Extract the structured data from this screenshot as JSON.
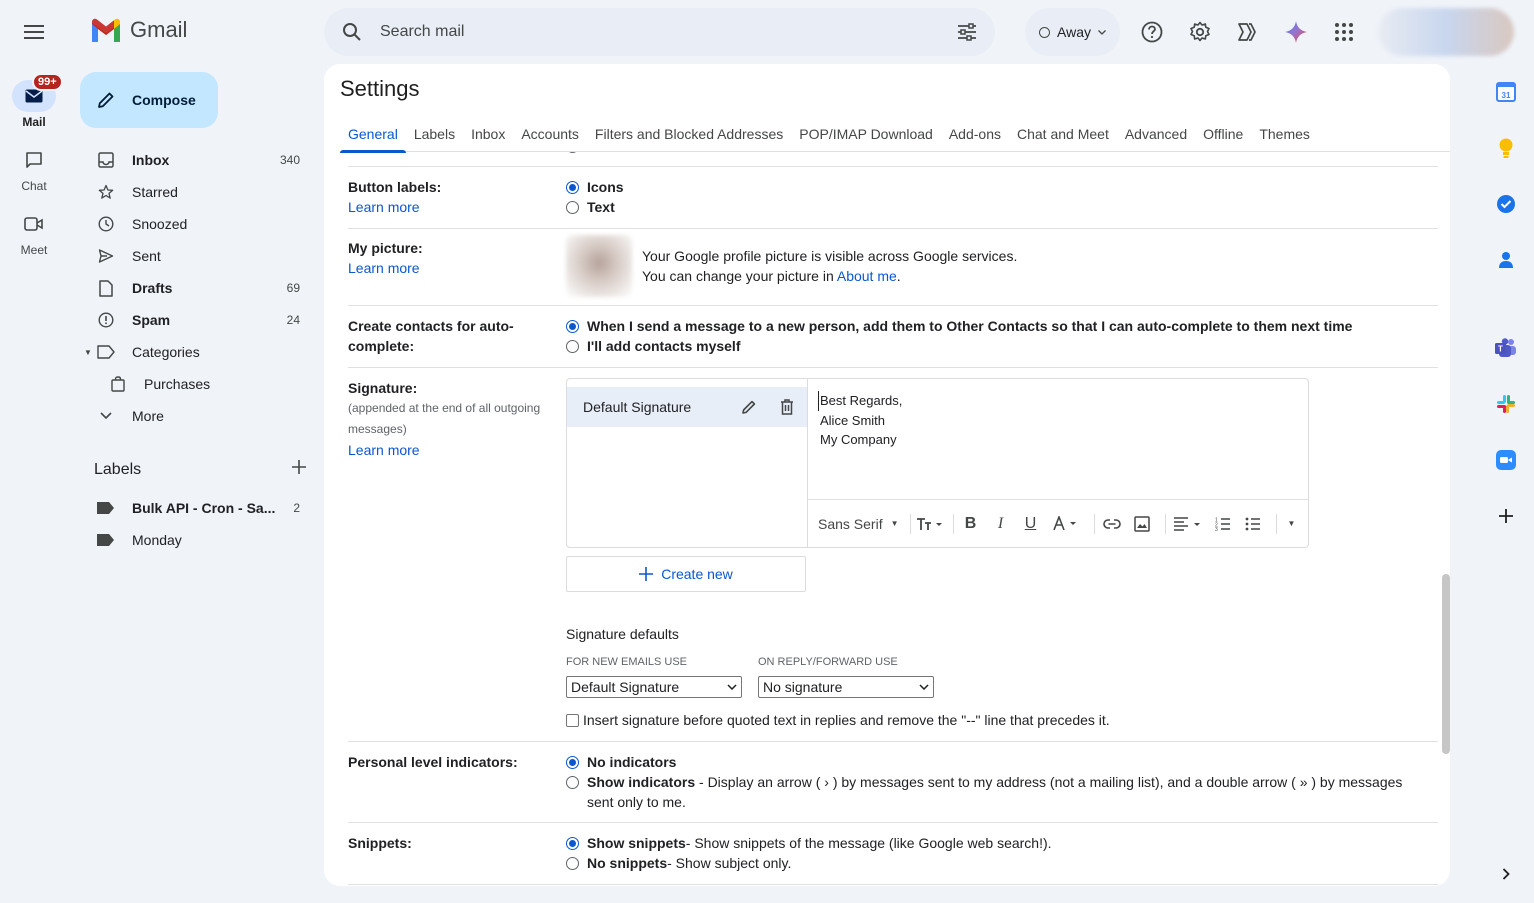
{
  "app": {
    "name": "Gmail"
  },
  "rail": {
    "items": [
      {
        "label": "Mail",
        "badge": "99+"
      },
      {
        "label": "Chat"
      },
      {
        "label": "Meet"
      }
    ]
  },
  "sidebar": {
    "compose": "Compose",
    "items": [
      {
        "label": "Inbox",
        "count": "340"
      },
      {
        "label": "Starred",
        "count": ""
      },
      {
        "label": "Snoozed",
        "count": ""
      },
      {
        "label": "Sent",
        "count": ""
      },
      {
        "label": "Drafts",
        "count": "69"
      },
      {
        "label": "Spam",
        "count": "24"
      },
      {
        "label": "Categories",
        "count": ""
      },
      {
        "label": "Purchases",
        "count": ""
      },
      {
        "label": "More",
        "count": ""
      }
    ],
    "labels_title": "Labels",
    "labels": [
      {
        "label": "Bulk API - Cron - Sa...",
        "count": "2"
      },
      {
        "label": "Monday",
        "count": ""
      }
    ]
  },
  "topbar": {
    "search_placeholder": "Search mail",
    "status": "Away"
  },
  "settings": {
    "title": "Settings",
    "tabs": [
      "General",
      "Labels",
      "Inbox",
      "Accounts",
      "Filters and Blocked Addresses",
      "POP/IMAP Download",
      "Add-ons",
      "Chat and Meet",
      "Advanced",
      "Offline",
      "Themes"
    ],
    "learn_more": "Learn more",
    "button_labels": {
      "label": "Button labels:",
      "options": [
        "Icons",
        "Text"
      ]
    },
    "my_picture": {
      "label": "My picture:",
      "line1": "Your Google profile picture is visible across Google services.",
      "line2_prefix": "You can change your picture in ",
      "line2_link": "About me",
      "line2_suffix": "."
    },
    "contacts": {
      "label": "Create contacts for auto-complete:",
      "options": [
        "When I send a message to a new person, add them to Other Contacts so that I can auto-complete to them next time",
        "I'll add contacts myself"
      ]
    },
    "signature": {
      "label": "Signature:",
      "sublabel": "(appended at the end of all outgoing messages)",
      "name": "Default Signature",
      "body": [
        "Best Regards,",
        "Alice Smith",
        "My Company"
      ],
      "font": "Sans Serif",
      "create_new": "Create new",
      "defaults_title": "Signature defaults",
      "new_emails_label": "FOR NEW EMAILS USE",
      "new_emails_value": "Default Signature",
      "reply_label": "ON REPLY/FORWARD USE",
      "reply_value": "No signature",
      "insert_before": "Insert signature before quoted text in replies and remove the \"--\" line that precedes it."
    },
    "personal_indicators": {
      "label": "Personal level indicators:",
      "opt1": "No indicators",
      "opt2_bold": "Show indicators",
      "opt2_desc": " - Display an arrow ( › ) by messages sent to my address (not a mailing list), and a double arrow ( » ) by messages sent only to me."
    },
    "snippets": {
      "label": "Snippets:",
      "opt1_bold": "Show snippets",
      "opt1_desc": " - Show snippets of the message (like Google web search!).",
      "opt2_bold": "No snippets",
      "opt2_desc": " - Show subject only."
    }
  },
  "colors": {
    "accent": "#0b57d0",
    "compose_bg": "#c2e7ff",
    "app_bg": "#f0f4f9"
  }
}
